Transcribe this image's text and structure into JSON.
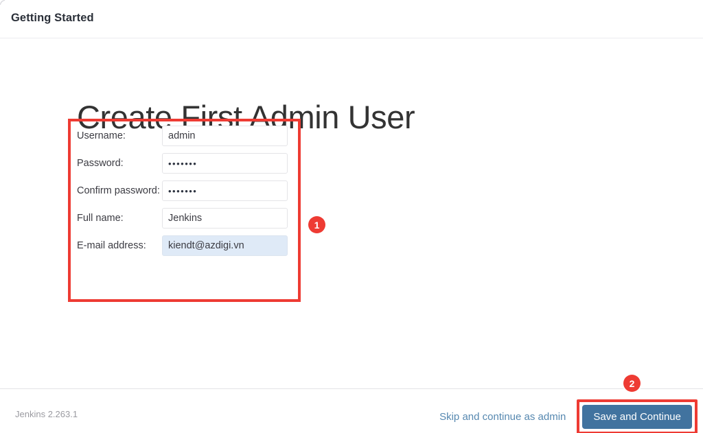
{
  "header": {
    "title": "Getting Started"
  },
  "main": {
    "page_title": "Create First Admin User",
    "form": {
      "fields": [
        {
          "label": "Username:",
          "name": "username",
          "type": "text",
          "value": "admin",
          "placeholder": "",
          "autofilled": false
        },
        {
          "label": "Password:",
          "name": "password",
          "type": "password",
          "value": "•••••••",
          "placeholder": "",
          "autofilled": false
        },
        {
          "label": "Confirm password:",
          "name": "confirm-password",
          "type": "password",
          "value": "•••••••",
          "placeholder": "",
          "autofilled": false
        },
        {
          "label": "Full name:",
          "name": "full-name",
          "type": "text",
          "value": "Jenkins",
          "placeholder": "",
          "autofilled": false
        },
        {
          "label": "E-mail address:",
          "name": "email",
          "type": "email",
          "value": "kiendt@azdigi.vn",
          "placeholder": "",
          "autofilled": true
        }
      ]
    }
  },
  "annotations": {
    "markers": [
      {
        "id": "marker-1",
        "label": "1",
        "target": "admin-user-form"
      },
      {
        "id": "marker-2",
        "label": "2",
        "target": "save-and-continue-button"
      }
    ],
    "highlight_color": "#ee3b33"
  },
  "footer": {
    "version": "Jenkins 2.263.1",
    "skip_label": "Skip and continue as admin",
    "save_label": "Save and Continue"
  },
  "colors": {
    "accent_red": "#ee3b33",
    "primary_button": "#41739f",
    "link_blue": "#5688b0",
    "autofill_blue": "#dfeaf7",
    "title_gray": "#333333",
    "divider": "#e3e3e6"
  }
}
